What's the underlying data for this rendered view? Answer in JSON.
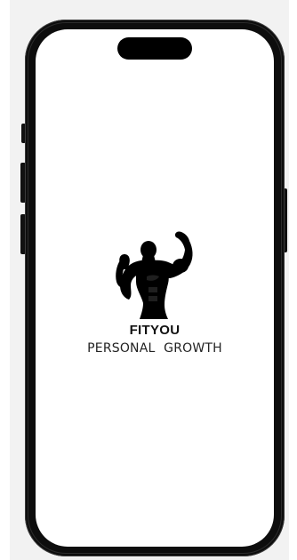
{
  "splash": {
    "brand_name": "FITYOU",
    "tagline": "PERSONAL  GROWTH",
    "logo_icon": "flexing-bodybuilder-icon"
  },
  "colors": {
    "device_frame": "#0d0d0d",
    "screen_background": "#ffffff",
    "backdrop": "#f2f2f2",
    "logo": "#000000",
    "text": "#111111"
  }
}
